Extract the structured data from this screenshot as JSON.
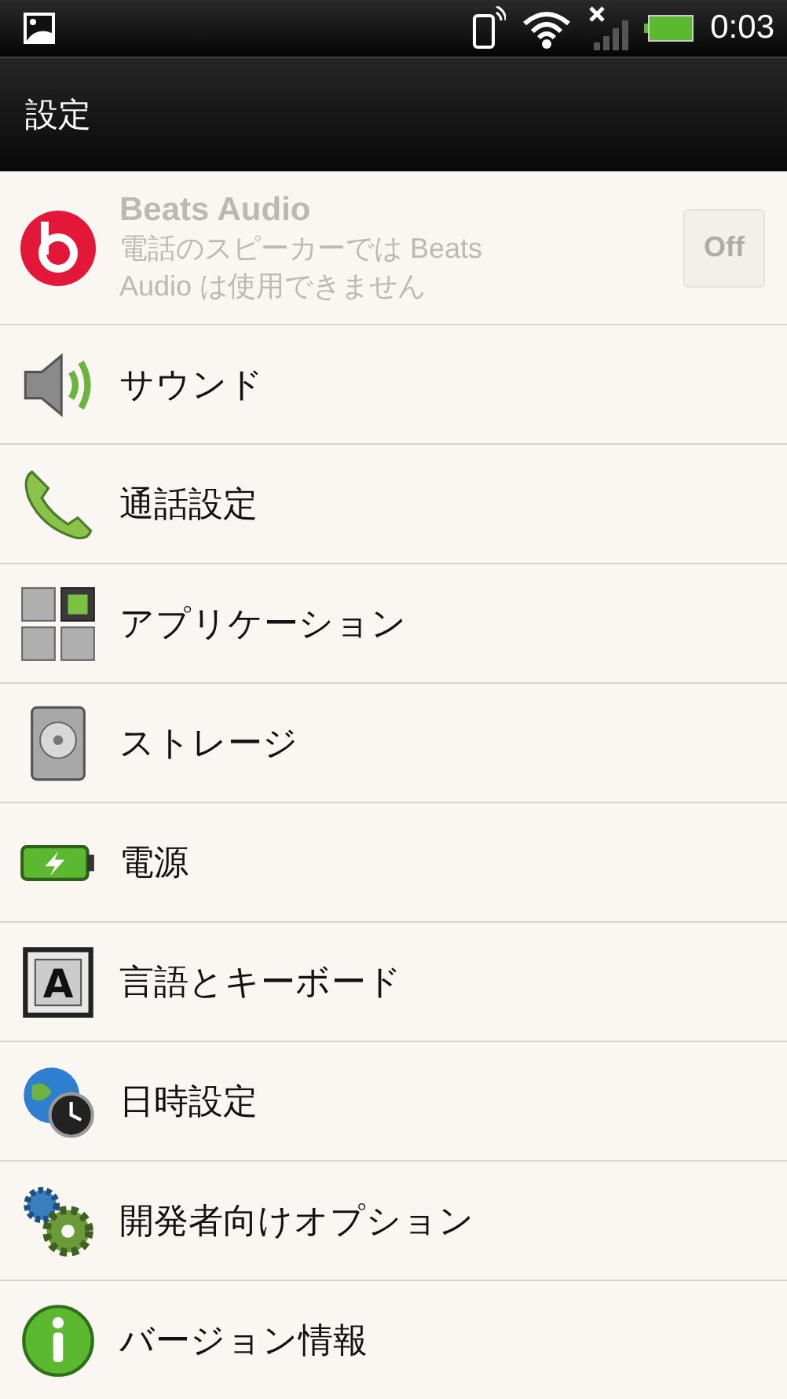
{
  "status_bar": {
    "time": "0:03"
  },
  "title_bar": {
    "title": "設定"
  },
  "beats": {
    "title": "Beats Audio",
    "summary": "電話のスピーカーでは Beats Audio は使用できません",
    "toggle_label": "Off",
    "on": false,
    "disabled": true
  },
  "items": [
    {
      "kind": "sound",
      "label": "サウンド"
    },
    {
      "kind": "phone",
      "label": "通話設定"
    },
    {
      "kind": "apps",
      "label": "アプリケーション"
    },
    {
      "kind": "storage",
      "label": "ストレージ"
    },
    {
      "kind": "power",
      "label": "電源"
    },
    {
      "kind": "language",
      "label": "言語とキーボード",
      "icon_text": "A"
    },
    {
      "kind": "datetime",
      "label": "日時設定"
    },
    {
      "kind": "developer",
      "label": "開発者向けオプション"
    },
    {
      "kind": "info",
      "label": "バージョン情報"
    }
  ]
}
